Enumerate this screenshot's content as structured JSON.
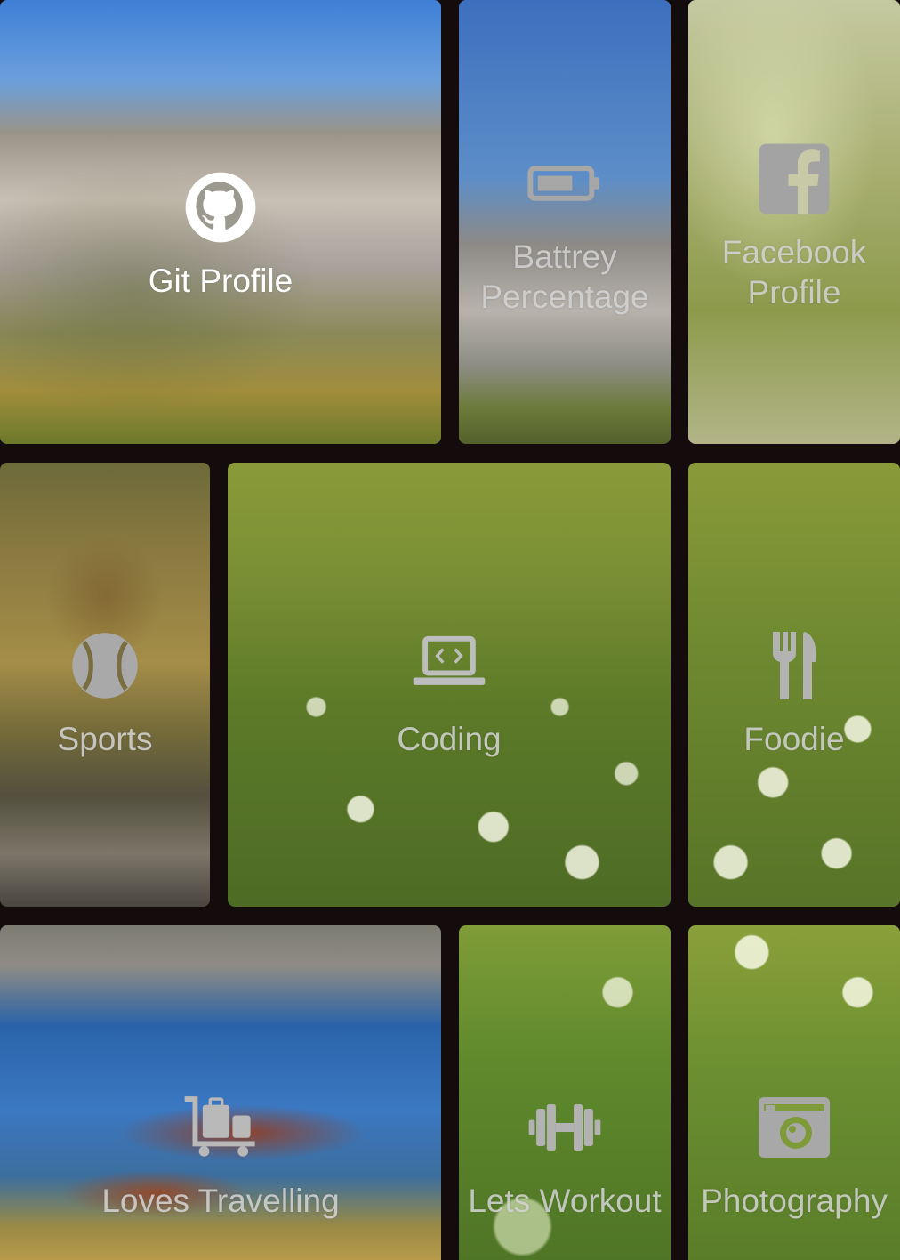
{
  "tiles": [
    {
      "label": "Git Profile",
      "icon": "github-icon"
    },
    {
      "label": "Battrey Percentage",
      "icon": "battery-icon"
    },
    {
      "label": "Facebook Profile",
      "icon": "facebook-icon"
    },
    {
      "label": "Sports",
      "icon": "baseball-icon"
    },
    {
      "label": "Coding",
      "icon": "laptop-code-icon"
    },
    {
      "label": "Foodie",
      "icon": "utensils-icon"
    },
    {
      "label": "Loves Travelling",
      "icon": "luggage-cart-icon"
    },
    {
      "label": "Lets Workout",
      "icon": "dumbbell-icon"
    },
    {
      "label": "Photography",
      "icon": "camera-icon"
    }
  ]
}
